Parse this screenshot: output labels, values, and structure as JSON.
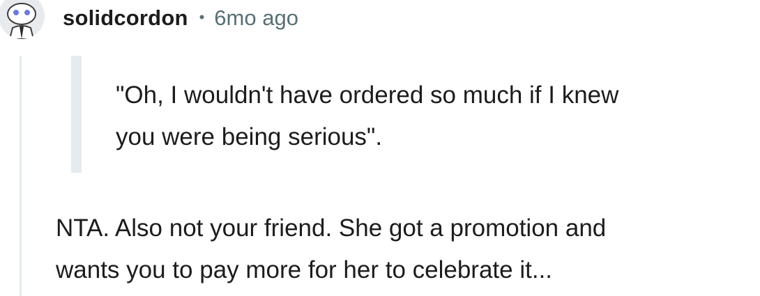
{
  "comment": {
    "author": "solidcordon",
    "separator": "•",
    "timestamp": "6mo ago",
    "avatar_icon": "snoo-avatar-icon",
    "quote_lines": [
      "\"Oh, I wouldn't have ordered so much if I knew",
      "you were being serious\"."
    ],
    "body_lines": [
      "NTA. Also not your friend. She got a promotion and",
      "wants you to pay more for her to celebrate it..."
    ]
  },
  "colors": {
    "text": "#1c1c1c",
    "meta": "#576f76",
    "rule": "#e5ebee"
  }
}
